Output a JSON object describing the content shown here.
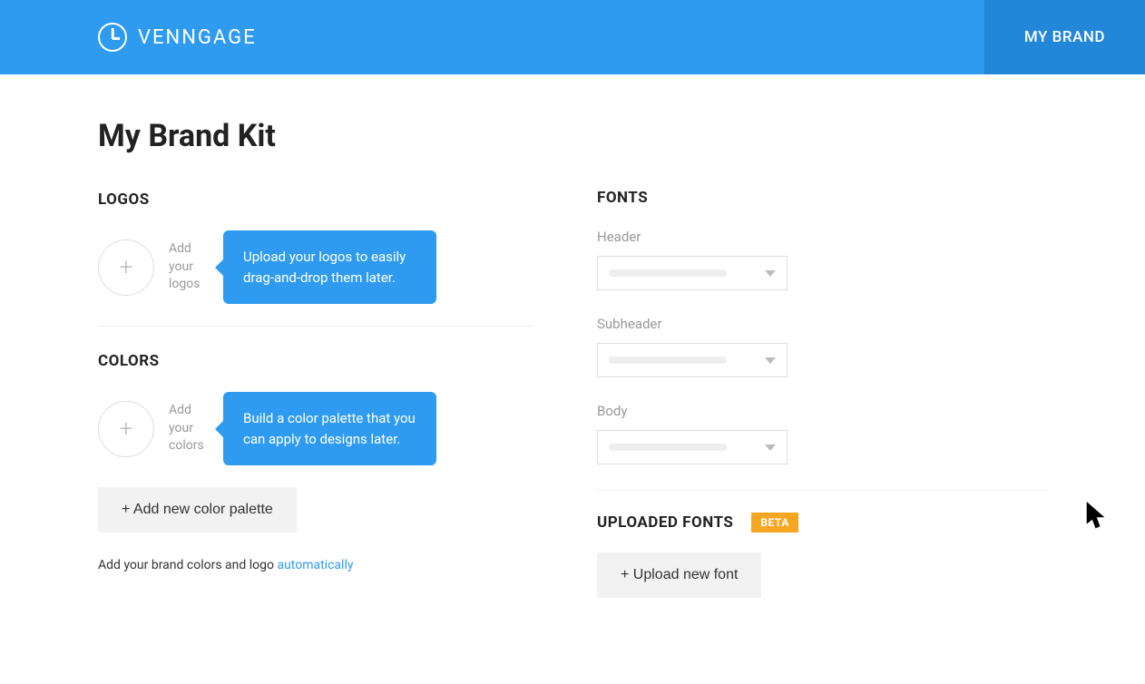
{
  "header": {
    "brand": "VENNGAGE",
    "nav_my_brand": "MY BRAND"
  },
  "page_title": "My Brand Kit",
  "logos": {
    "section_title": "LOGOS",
    "add_label": "Add your logos",
    "tooltip": "Upload your logos to easily drag-and-drop them later."
  },
  "colors": {
    "section_title": "COLORS",
    "add_label": "Add your colors",
    "tooltip": "Build a color palette that you can apply to designs later.",
    "add_palette_btn": "+ Add new color palette"
  },
  "helper": {
    "prefix": "Add your brand colors and logo ",
    "link": "automatically"
  },
  "fonts": {
    "section_title": "FONTS",
    "header_label": "Header",
    "subheader_label": "Subheader",
    "body_label": "Body"
  },
  "uploaded_fonts": {
    "section_title": "UPLOADED FONTS",
    "badge": "BETA",
    "upload_btn": "+ Upload new font"
  }
}
